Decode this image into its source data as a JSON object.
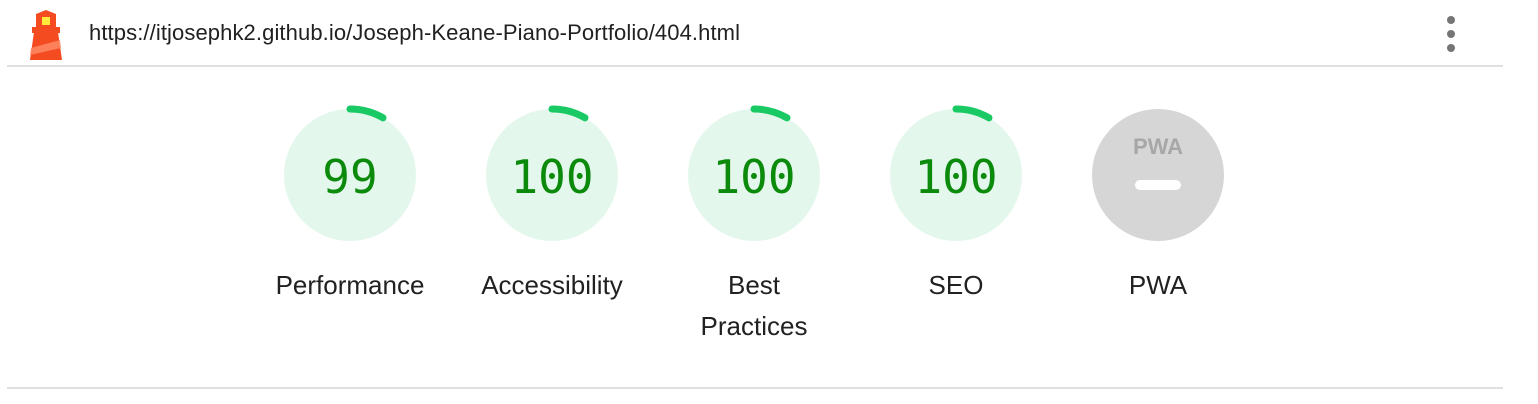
{
  "header": {
    "url": "https://itjosephk2.github.io/Joseph-Keane-Piano-Portfolio/404.html"
  },
  "gauges": [
    {
      "label": "Performance",
      "score": 99,
      "display": "99",
      "status": "pass"
    },
    {
      "label": "Accessibility",
      "score": 100,
      "display": "100",
      "status": "pass"
    },
    {
      "label": "Best Practices",
      "score": 100,
      "display": "100",
      "status": "pass"
    },
    {
      "label": "SEO",
      "score": 100,
      "display": "100",
      "status": "pass"
    },
    {
      "label": "PWA",
      "score": null,
      "display": "",
      "status": "not-applicable",
      "badge_text": "PWA"
    }
  ],
  "colors": {
    "pass_fill": "#e3f7ec",
    "pass_arc": "#18c964",
    "pass_text": "#0c8a0c",
    "pwa_fill": "#d6d6d6",
    "pwa_text": "#a7a7a7"
  }
}
